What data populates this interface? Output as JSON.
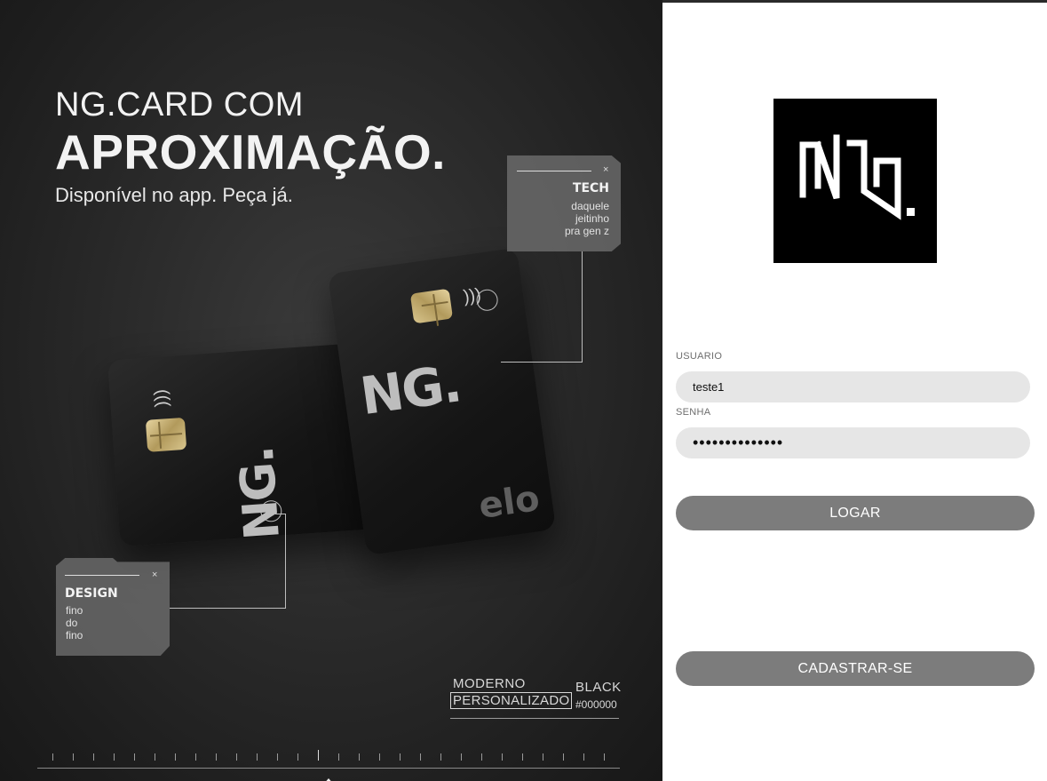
{
  "promo": {
    "headline_line1": "NG.CARD COM",
    "headline_line2": "APROXIMAÇÃO.",
    "subheadline": "Disponível no app. Peça já.",
    "card_logo": "NG.",
    "card_brand": "elo",
    "callout_tech": {
      "title": "TECH",
      "lines": [
        "daquele",
        "jeitinho",
        "pra gen z"
      ],
      "close": "×"
    },
    "callout_design": {
      "title": "DESIGN",
      "lines": [
        "fino",
        "do",
        "fino"
      ],
      "close": "×"
    },
    "tag": {
      "moderno": "MODERNO",
      "personalizado": "PERSONALIZADO",
      "black": "BLACK",
      "hex": "#000000"
    }
  },
  "login": {
    "logo_alt": "NG.",
    "username_label": "USUARIO",
    "username_value": "teste1",
    "password_label": "SENHA",
    "password_value": "teste1teste1te",
    "login_button": "LOGAR",
    "register_button": "CADASTRAR-SE"
  },
  "colors": {
    "panel_dark": "#2c2c2c",
    "button_gray": "#7c7c7c",
    "input_bg": "#e6e6e6"
  }
}
